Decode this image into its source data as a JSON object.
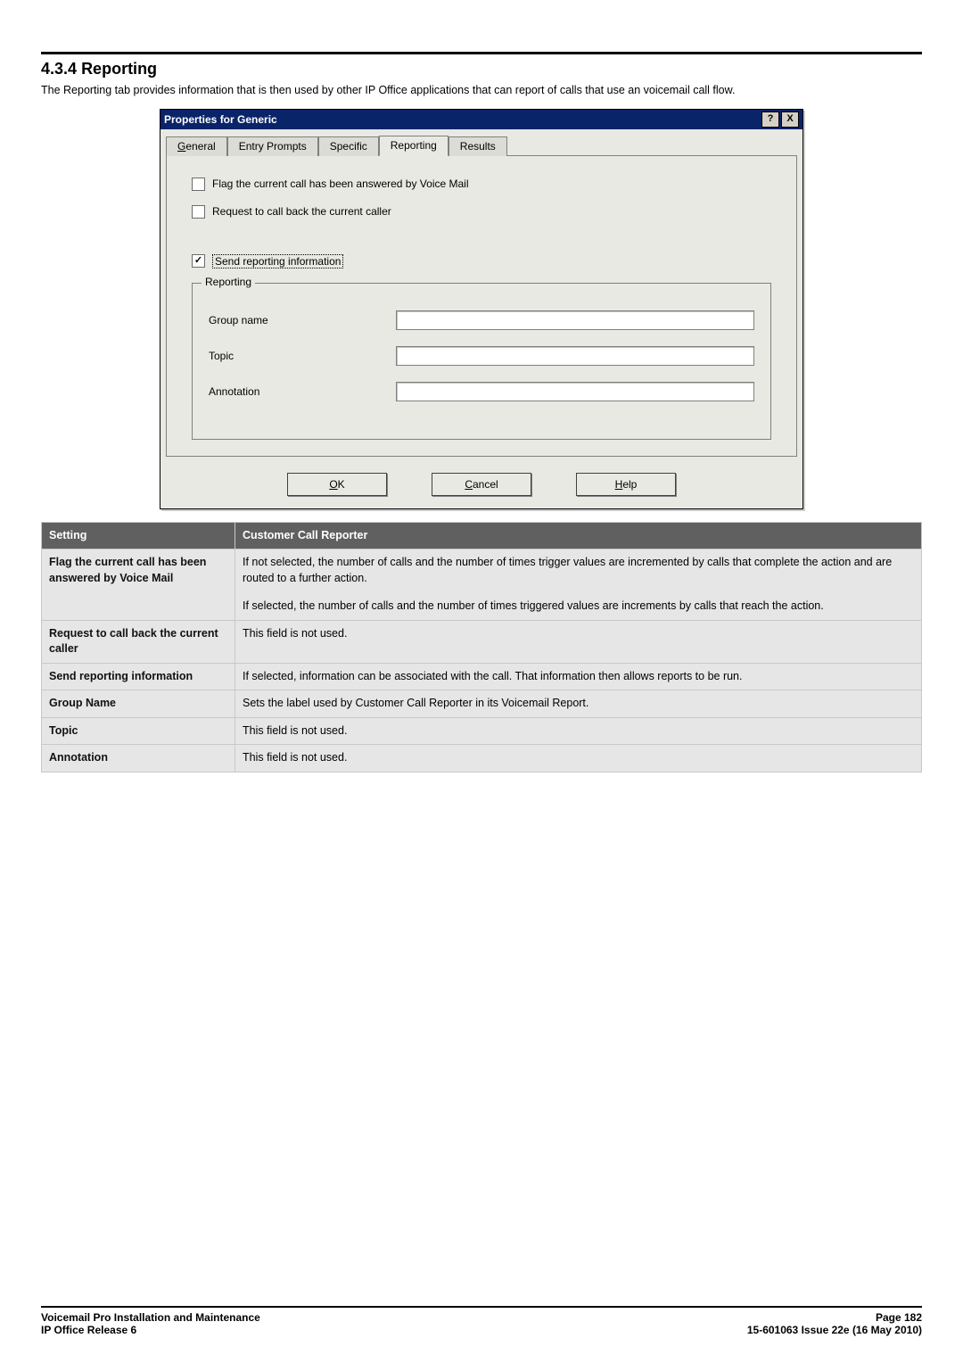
{
  "doc": {
    "section_number": "4.3.4",
    "section_title": "Reporting",
    "intro_text": "The Reporting tab provides information that is then used by other IP Office applications that can report of calls that use an voicemail call flow."
  },
  "dialog": {
    "title": "Properties for Generic",
    "help_btn": "?",
    "close_btn": "X",
    "tabs": [
      {
        "label_pre": "",
        "underline": "G",
        "label_post": "eneral",
        "active": false
      },
      {
        "label_pre": "Entry Prompts",
        "underline": "",
        "label_post": "",
        "active": false
      },
      {
        "label_pre": "Specific",
        "underline": "",
        "label_post": "",
        "active": false
      },
      {
        "label_pre": "Reporting",
        "underline": "",
        "label_post": "",
        "active": true
      },
      {
        "label_pre": "Results",
        "underline": "",
        "label_post": "",
        "active": false
      }
    ],
    "checkboxes": {
      "flag_answered": {
        "checked": false,
        "label": "Flag the current call has been answered by Voice Mail"
      },
      "request_callback": {
        "checked": false,
        "label": "Request to call back the current caller"
      },
      "send_reporting": {
        "checked": true,
        "label": "Send reporting information"
      }
    },
    "fieldset_legend": "Reporting",
    "fields": {
      "group_name": {
        "label": "Group name",
        "value": ""
      },
      "topic": {
        "label": "Topic",
        "value": ""
      },
      "annotation": {
        "label": "Annotation",
        "value": ""
      }
    },
    "buttons": {
      "ok": {
        "underline": "O",
        "rest": "K"
      },
      "cancel": {
        "underline": "C",
        "rest": "ancel"
      },
      "help": {
        "underline": "H",
        "rest": "elp"
      }
    }
  },
  "table": {
    "headers": {
      "setting": "Setting",
      "desc": "Customer Call Reporter"
    },
    "rows": [
      {
        "setting": "Flag the current call has been answered by Voice Mail",
        "desc_parts": [
          "If not selected, the number of calls and the number of times trigger values are incremented by calls that complete the action and are routed to a further action.",
          "If selected, the number of calls and the number of times triggered values are increments by calls that reach the action."
        ]
      },
      {
        "setting": "Request to call back the current caller",
        "desc_parts": [
          "This field is not used."
        ]
      },
      {
        "setting": "Send reporting information",
        "desc_parts": [
          "If selected, information can be associated with the call. That information then allows reports to be run."
        ]
      },
      {
        "setting": "Group Name",
        "desc_parts": [
          "Sets the label used by Customer Call Reporter in its Voicemail Report."
        ]
      },
      {
        "setting": "Topic",
        "desc_parts": [
          "This field is not used."
        ]
      },
      {
        "setting": "Annotation",
        "desc_parts": [
          "This field is not used."
        ]
      }
    ]
  },
  "footer": {
    "left_line1": "Voicemail Pro Installation and Maintenance",
    "left_line2": "IP Office Release 6",
    "right_line1": "Page 182",
    "right_line2": "15-601063 Issue 22e (16 May 2010)"
  }
}
